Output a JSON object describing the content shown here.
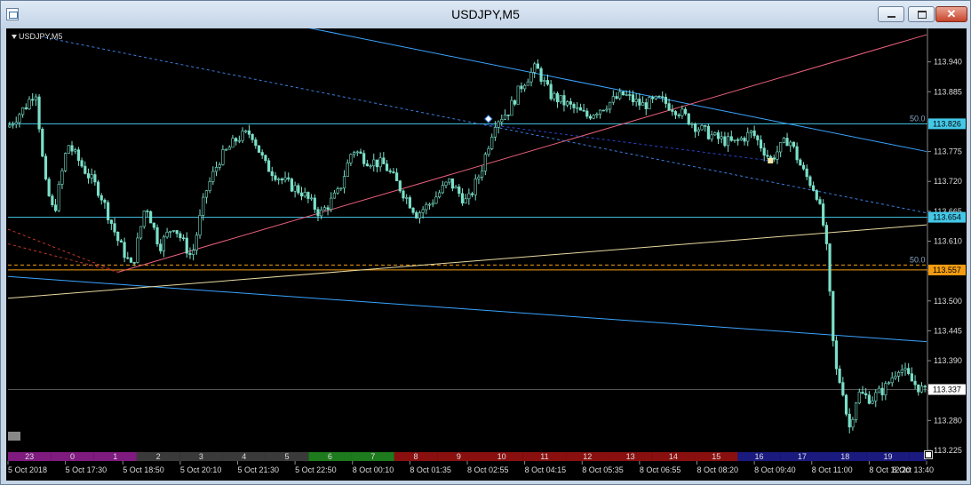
{
  "window": {
    "title": "USDJPY,M5",
    "minimize_label": "",
    "maximize_label": "",
    "close_label": "✕"
  },
  "chart": {
    "symbol_label": "USDJPY,M5",
    "colors": {
      "background": "#000000",
      "candle": "#7be0c9",
      "grid": "#1a1a1a",
      "axis_text": "#dddddd",
      "level_cyan": "#44c8e8",
      "level_orange": "#f39c12",
      "trend_blue": "#3aa4ff",
      "trend_pink": "#e8607a",
      "trend_yellow": "#e8d9a0",
      "dashed_blue": "#3a7fe0",
      "dashed_darkblue": "#2a44c8",
      "dashed_red": "#c0392b",
      "current_price_bg": "#ffffff"
    }
  },
  "chart_data": {
    "type": "candlestick",
    "price_axis_ticks": [
      "113.940",
      "113.885",
      "113.830",
      "113.775",
      "113.720",
      "113.665",
      "113.610",
      "113.555",
      "113.500",
      "113.445",
      "113.390",
      "113.335",
      "113.280",
      "113.225"
    ],
    "price_badges": [
      {
        "label": "113.826",
        "value": 113.826,
        "style": "cyan"
      },
      {
        "label": "113.654",
        "value": 113.654,
        "style": "cyan"
      },
      {
        "label": "113.557",
        "value": 113.557,
        "style": "orange"
      },
      {
        "label": "113.337",
        "value": 113.337,
        "style": "white"
      }
    ],
    "fib_labels": [
      {
        "text": "50.0",
        "value": 113.826
      },
      {
        "text": "50.0",
        "value": 113.566
      }
    ],
    "time_labels": [
      "5 Oct 2018",
      "5 Oct 17:30",
      "5 Oct 18:50",
      "5 Oct 20:10",
      "5 Oct 21:30",
      "5 Oct 22:50",
      "8 Oct 00:10",
      "8 Oct 01:35",
      "8 Oct 02:55",
      "8 Oct 04:15",
      "8 Oct 05:35",
      "8 Oct 06:55",
      "8 Oct 08:20",
      "8 Oct 09:40",
      "8 Oct 11:00",
      "8 Oct 12:20",
      "8 Oct 13:40"
    ],
    "session_hours": [
      {
        "label": "23",
        "color": "#7f1a7f"
      },
      {
        "label": "0",
        "color": "#7f1a7f"
      },
      {
        "label": "1",
        "color": "#7f1a7f"
      },
      {
        "label": "2",
        "color": "#3a3a3a"
      },
      {
        "label": "3",
        "color": "#3a3a3a"
      },
      {
        "label": "4",
        "color": "#3a3a3a"
      },
      {
        "label": "5",
        "color": "#3a3a3a"
      },
      {
        "label": "6",
        "color": "#1d7a1d"
      },
      {
        "label": "7",
        "color": "#1d7a1d"
      },
      {
        "label": "8",
        "color": "#8a1010"
      },
      {
        "label": "9",
        "color": "#8a1010"
      },
      {
        "label": "10",
        "color": "#8a1010"
      },
      {
        "label": "11",
        "color": "#8a1010"
      },
      {
        "label": "12",
        "color": "#8a1010"
      },
      {
        "label": "13",
        "color": "#8a1010"
      },
      {
        "label": "14",
        "color": "#8a1010"
      },
      {
        "label": "15",
        "color": "#8a1010"
      },
      {
        "label": "16",
        "color": "#1a1a7f"
      },
      {
        "label": "17",
        "color": "#1a1a7f"
      },
      {
        "label": "18",
        "color": "#1a1a7f"
      },
      {
        "label": "19",
        "color": "#1a1a7f"
      },
      {
        "label": "",
        "color": "#1a1a7f"
      }
    ],
    "horizontal_levels": [
      {
        "value": 113.826,
        "color": "#44c8e8",
        "dash": "none"
      },
      {
        "value": 113.654,
        "color": "#44c8e8",
        "dash": "none"
      },
      {
        "value": 113.566,
        "color": "#f39c12",
        "dash": "4,3"
      },
      {
        "value": 113.557,
        "color": "#f39c12",
        "dash": "none"
      },
      {
        "value": 113.337,
        "color": "#555555",
        "dash": "none"
      }
    ],
    "trend_lines": [
      {
        "from": [
          0.32,
          114.005
        ],
        "to": [
          1.0,
          113.775
        ],
        "color": "#3aa4ff",
        "dash": "none"
      },
      {
        "from": [
          0.0,
          113.545
        ],
        "to": [
          1.0,
          113.425
        ],
        "color": "#3aa4ff",
        "dash": "none"
      },
      {
        "from": [
          0.12,
          113.553
        ],
        "to": [
          1.0,
          113.99
        ],
        "color": "#e8607a",
        "dash": "none"
      },
      {
        "from": [
          0.0,
          113.505
        ],
        "to": [
          1.0,
          113.64
        ],
        "color": "#e8d9a0",
        "dash": "none"
      },
      {
        "from": [
          0.04,
          113.985
        ],
        "to": [
          1.0,
          113.662
        ],
        "color": "#3a7fe0",
        "dash": "3,3"
      },
      {
        "from": [
          0.52,
          113.825
        ],
        "to": [
          0.83,
          113.758
        ],
        "color": "#2a44c8",
        "dash": "3,3"
      },
      {
        "from": [
          0.0,
          113.632
        ],
        "to": [
          0.12,
          113.553
        ],
        "color": "#c0392b",
        "dash": "3,3"
      },
      {
        "from": [
          0.0,
          113.605
        ],
        "to": [
          0.12,
          113.553
        ],
        "color": "#c0392b",
        "dash": "3,3"
      }
    ],
    "path": [
      [
        0.0,
        113.82
      ],
      [
        0.02,
        113.86
      ],
      [
        0.03,
        113.89
      ],
      [
        0.04,
        113.72
      ],
      [
        0.05,
        113.66
      ],
      [
        0.065,
        113.79
      ],
      [
        0.08,
        113.75
      ],
      [
        0.1,
        113.7
      ],
      [
        0.12,
        113.61
      ],
      [
        0.135,
        113.56
      ],
      [
        0.15,
        113.68
      ],
      [
        0.165,
        113.6
      ],
      [
        0.18,
        113.64
      ],
      [
        0.2,
        113.58
      ],
      [
        0.215,
        113.7
      ],
      [
        0.23,
        113.76
      ],
      [
        0.25,
        113.8
      ],
      [
        0.265,
        113.81
      ],
      [
        0.28,
        113.75
      ],
      [
        0.3,
        113.72
      ],
      [
        0.32,
        113.7
      ],
      [
        0.34,
        113.66
      ],
      [
        0.36,
        113.7
      ],
      [
        0.375,
        113.78
      ],
      [
        0.39,
        113.76
      ],
      [
        0.41,
        113.75
      ],
      [
        0.43,
        113.7
      ],
      [
        0.445,
        113.66
      ],
      [
        0.46,
        113.68
      ],
      [
        0.48,
        113.72
      ],
      [
        0.5,
        113.68
      ],
      [
        0.515,
        113.74
      ],
      [
        0.53,
        113.83
      ],
      [
        0.545,
        113.85
      ],
      [
        0.56,
        113.9
      ],
      [
        0.575,
        113.93
      ],
      [
        0.59,
        113.88
      ],
      [
        0.61,
        113.86
      ],
      [
        0.63,
        113.84
      ],
      [
        0.65,
        113.86
      ],
      [
        0.67,
        113.88
      ],
      [
        0.69,
        113.86
      ],
      [
        0.71,
        113.87
      ],
      [
        0.73,
        113.85
      ],
      [
        0.75,
        113.82
      ],
      [
        0.77,
        113.8
      ],
      [
        0.79,
        113.79
      ],
      [
        0.81,
        113.81
      ],
      [
        0.83,
        113.76
      ],
      [
        0.85,
        113.8
      ],
      [
        0.865,
        113.74
      ],
      [
        0.88,
        113.7
      ],
      [
        0.89,
        113.62
      ],
      [
        0.895,
        113.5
      ],
      [
        0.9,
        113.38
      ],
      [
        0.91,
        113.33
      ],
      [
        0.915,
        113.26
      ],
      [
        0.925,
        113.33
      ],
      [
        0.94,
        113.32
      ],
      [
        0.955,
        113.34
      ],
      [
        0.97,
        113.38
      ],
      [
        0.985,
        113.35
      ],
      [
        1.0,
        113.33
      ]
    ],
    "markers": [
      {
        "at": [
          0.523,
          113.835
        ],
        "shape": "diamond",
        "color": "#ffffff"
      },
      {
        "at": [
          0.83,
          113.758
        ],
        "shape": "square",
        "color": "#f5e6a8"
      }
    ],
    "ylim": [
      113.225,
      113.995
    ]
  }
}
